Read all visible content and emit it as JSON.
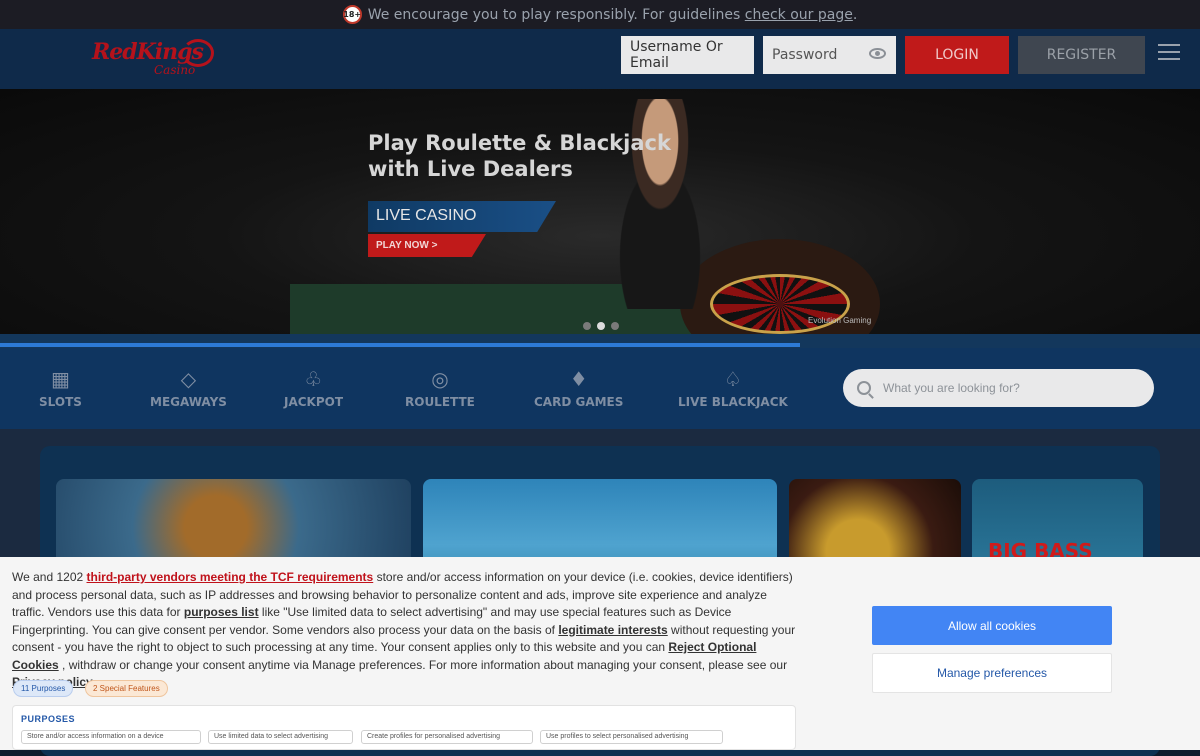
{
  "top_notice": {
    "badge": "18+",
    "text": "We encourage you to play responsibly. For guidelines ",
    "link": "check our page",
    "suffix": "."
  },
  "header": {
    "logo_brand": "RedKings",
    "logo_sub": "Casino",
    "username_placeholder": "Username Or Email",
    "password_placeholder": "Password",
    "login_label": "LOGIN",
    "register_label": "REGISTER"
  },
  "hero": {
    "title_line1": "Play Roulette & Blackjack",
    "title_line2": "with Live Dealers",
    "tag": "LIVE CASINO",
    "cta": "PLAY NOW >",
    "provider": "Evolution Gaming",
    "slides": 3,
    "active_slide": 2
  },
  "categories": [
    {
      "label": "SLOTS",
      "icon": "slot-machine-icon"
    },
    {
      "label": "MEGAWAYS",
      "icon": "diamond-icon"
    },
    {
      "label": "JACKPOT",
      "icon": "clover-icon"
    },
    {
      "label": "ROULETTE",
      "icon": "roulette-icon"
    },
    {
      "label": "CARD GAMES",
      "icon": "cards-icon"
    },
    {
      "label": "LIVE BLACKJACK",
      "icon": "spade-icon"
    }
  ],
  "search": {
    "placeholder": "What you are looking for?"
  },
  "games": {
    "tile4_text": "BIG BASS"
  },
  "cookie": {
    "p1": "We and 1202 ",
    "vendors_link": "third-party vendors meeting the TCF requirements",
    "p2": " store and/or access information on your device (i.e. cookies, device identifiers) and process personal data, such as IP addresses and browsing behavior to personalize content and ads, improve site experience and analyze traffic. Vendors use this data for ",
    "purposes_link": "purposes list",
    "p3": " like \"Use limited data to select advertising\" and may use special features such as Device Fingerprinting. You can give consent per vendor. Some vendors also process your data on the basis of ",
    "legit_link": "legitimate interests",
    "p4": " without requesting your consent - you have the right to object to such processing at any time. Your consent applies only to this website and you can ",
    "reject_link": "Reject Optional Cookies",
    "p5": " , withdraw or change your consent anytime via Manage preferences. For more information about managing your consent, please see our ",
    "privacy_link": "Privacy policy",
    "purposes_tag": "11 Purposes",
    "special_tag": "2 Special Features",
    "purposes_title": "PURPOSES",
    "chips": [
      "Store and/or access information on a device",
      "Use limited data to select advertising",
      "Create profiles for personalised advertising",
      "Use profiles to select personalised advertising"
    ],
    "allow_label": "Allow all cookies",
    "manage_label": "Manage preferences"
  }
}
